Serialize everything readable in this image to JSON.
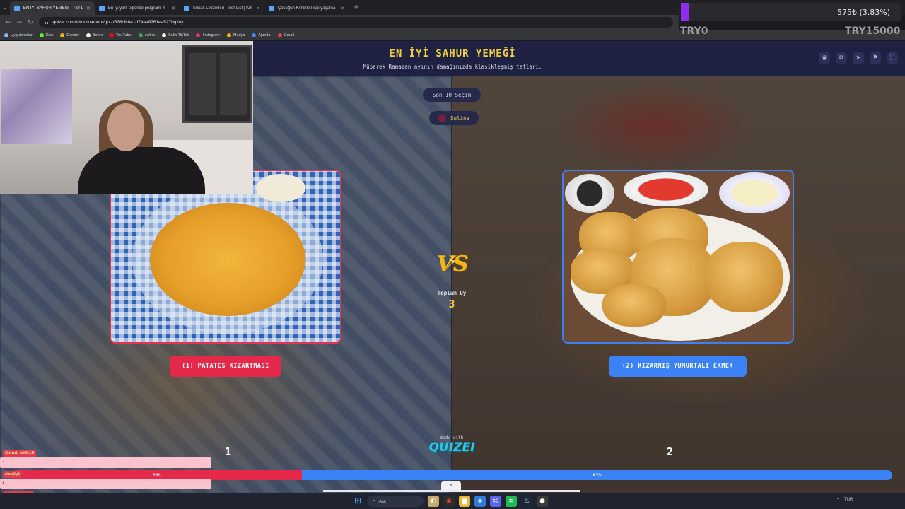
{
  "browser": {
    "tabs": [
      {
        "title": "EN İYİ SAHUR YEMEĞİ - Tier List",
        "active": true
      },
      {
        "title": "En iyi yerli eğlence programı h",
        "active": false
      },
      {
        "title": "Sokak Lezzetleri - Tier List | Kim",
        "active": false
      },
      {
        "title": "Çocuğun Kiminle İlişki yaşarsa",
        "active": false
      }
    ],
    "new_tab": "+",
    "url": "quizei.com/tr/tournament/quiz/678cfc841d74ae8761ea527b/play",
    "bookmarks": [
      {
        "label": "Uygulamalar",
        "color": "#8ab4f8"
      },
      {
        "label": "Kick",
        "color": "#53fc18"
      },
      {
        "label": "Donate",
        "color": "#f4b400"
      },
      {
        "label": "Botrix",
        "color": "#ffffff"
      },
      {
        "label": "YouTube",
        "color": "#ff0000"
      },
      {
        "label": "sulina",
        "color": "#34a853"
      },
      {
        "label": "Sulin TikTok",
        "color": "#eeeeee"
      },
      {
        "label": "Instagram",
        "color": "#e1306c"
      },
      {
        "label": "Medya",
        "color": "#f4b400"
      },
      {
        "label": "Ajanda",
        "color": "#4285f4"
      },
      {
        "label": "Gmail",
        "color": "#ea4335"
      }
    ]
  },
  "stream_overlay": {
    "goal_value": "575₺ (3.83%)",
    "goal_progress": 0.0383,
    "goal_start": "TRY0",
    "goal_target": "TRY15000"
  },
  "quiz": {
    "title": "EN İYİ SAHUR YEMEĞİ",
    "subtitle": "Mübarek Ramazan ayının damağımızda klasikleşmiş tatları.",
    "header_icons": [
      "eye-icon",
      "copy-icon",
      "send-icon",
      "flag-icon",
      "expand-icon"
    ],
    "last_pick_label": "Son 10 Seçim",
    "last_pick_user": "Sulina",
    "left_choice": "(1) PATATES KIZARTMASI",
    "right_choice": "(2) KIZARMIŞ YUMURTALI EKMEK",
    "vs_label": "VS",
    "total_votes_label": "Toplam Oy",
    "total_votes": "3",
    "made_with": "made with",
    "brand": "QUIZEI",
    "left_rank": "1",
    "right_rank": "2",
    "left_percent_label": "33%",
    "right_percent_label": "67%",
    "left_percent": 33,
    "right_percent": 67,
    "colors": {
      "left": "#e5294a",
      "right": "#3b82f6",
      "accent": "#f2d03b"
    }
  },
  "chat": [
    {
      "name": "dmmt_sdik16",
      "text": "2"
    },
    {
      "name": "sbejiyt",
      "text": "1"
    },
    {
      "name": "SAIZEN_nmt",
      "text": ""
    }
  ],
  "taskbar": {
    "search_placeholder": "Ara",
    "tray_lang": "TUR"
  }
}
